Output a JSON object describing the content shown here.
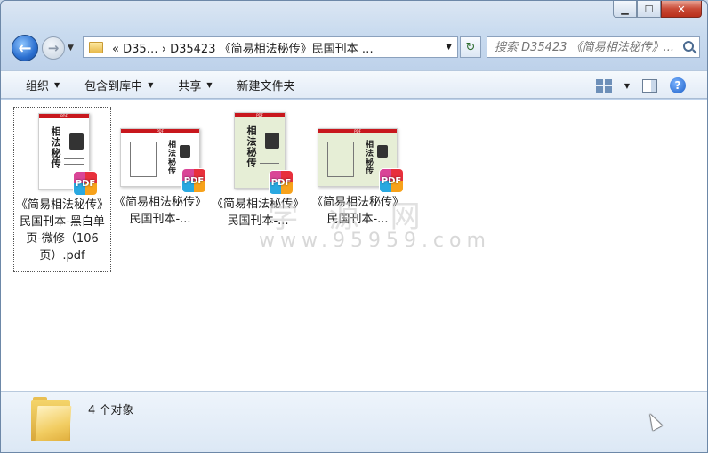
{
  "window": {
    "caption": {
      "minimize": "▁",
      "maximize": "☐",
      "close": "✕"
    }
  },
  "address": {
    "path_text": "«  D35…  ›  D35423 《简易相法秘传》民国刊本 …",
    "search_placeholder": "搜索 D35423 《简易相法秘传》..."
  },
  "toolbar": {
    "organize": "组织",
    "include_in_library": "包含到库中",
    "share": "共享",
    "new_folder": "新建文件夹"
  },
  "files": [
    {
      "label": "《简易相法秘传》民国刊本-黑白单页-微修（106页）.pdf",
      "badge": "PDF",
      "selected": true,
      "style": "white-single"
    },
    {
      "label": "《简易相法秘传》民国刊本-...",
      "badge": "PDF",
      "selected": false,
      "style": "white-double"
    },
    {
      "label": "《简易相法秘传》民国刊本-...",
      "badge": "PDF",
      "selected": false,
      "style": "green-single"
    },
    {
      "label": "《简易相法秘传》民国刊本-...",
      "badge": "PDF",
      "selected": false,
      "style": "green-double"
    }
  ],
  "thumb_text": {
    "title": "相法秘传",
    "bar": "PDF"
  },
  "watermark": {
    "line1": "学 源 网",
    "line2": "www.95959.com"
  },
  "status": {
    "count_text": "4 个对象"
  },
  "colors": {
    "accent": "#2b6fd0",
    "pdf_red": "#c8171d",
    "green_page": "#e6eed6"
  }
}
